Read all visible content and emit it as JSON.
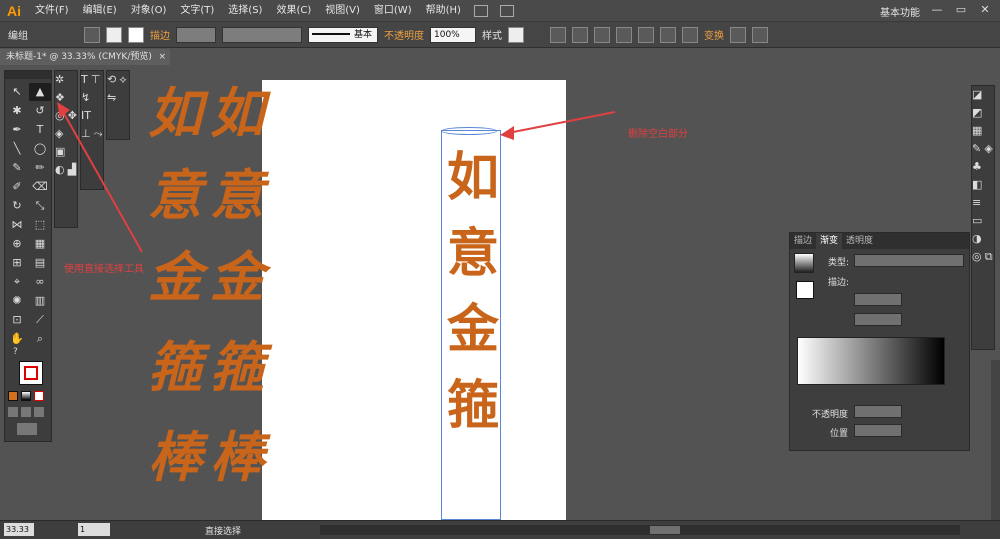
{
  "app": {
    "logo": "Ai",
    "workspace": "基本功能"
  },
  "menu": [
    "文件(F)",
    "编辑(E)",
    "对象(O)",
    "文字(T)",
    "选择(S)",
    "效果(C)",
    "视图(V)",
    "窗口(W)",
    "帮助(H)"
  ],
  "controlbar": {
    "mode": "编组",
    "stroke_label": "描边",
    "stroke_style": "基本",
    "opacity_label": "不透明度",
    "opacity_value": "100%",
    "style_label": "样式",
    "transform_label": "变换"
  },
  "document": {
    "tab_title": "未标题-1* @ 33.33% (CMYK/预览)",
    "close": "×"
  },
  "canvas": {
    "calligraphy_left": [
      "如",
      "意",
      "金",
      "箍",
      "棒"
    ],
    "calligraphy_right": [
      "如",
      "意",
      "金",
      "箍",
      "棒"
    ],
    "column_chars": [
      "如",
      "意",
      "金",
      "箍"
    ],
    "annotation_right": "删除空白部分",
    "annotation_left": "使用直接选择工具"
  },
  "gradient_panel": {
    "tabs": [
      "描边",
      "渐变",
      "透明度"
    ],
    "active_tab": "渐变",
    "type_label": "类型:",
    "stroke_label": "描边:",
    "opacity_label": "不透明度",
    "position_label": "位置"
  },
  "statusbar": {
    "zoom": "33.33",
    "page": "1",
    "tool_name": "直接选择"
  },
  "colors": {
    "accent": "#ff9a00",
    "calligraphy": "#c8651a",
    "selection": "#5a86d8",
    "annotation": "#e04040"
  }
}
